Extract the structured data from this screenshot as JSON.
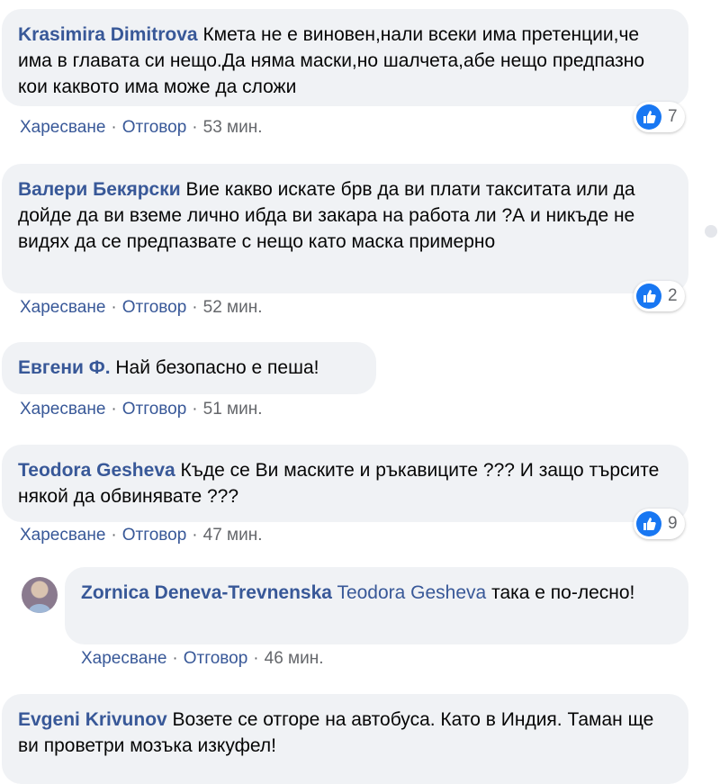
{
  "actions": {
    "like": "Харесване",
    "reply": "Отговор",
    "sep": "·"
  },
  "comments": [
    {
      "author": "Krasimira Dimitrova",
      "text": "Кмета не е виновен,нали всеки има претенции,че има в главата си нещо.Да няма маски,но шалчета,абе нещо предпазно кои каквото има може да сложи",
      "time": "53 мин.",
      "likes": "7"
    },
    {
      "author": "Валери Бекярски",
      "text": "Вие какво искате брв да ви плати такситата или да дойде да ви вземе лично ибда ви закара на работа ли ?А и никъде не видях да се предпазвате с нещо като маска примерно",
      "time": "52 мин.",
      "likes": "2"
    },
    {
      "author": "Евгени Ф.",
      "text": "Най безопасно е пеша!",
      "time": "51 мин."
    },
    {
      "author": "Teodora Gesheva",
      "text": "Къде се Ви маските и ръкавиците ??? И защо търсите някой да обвинявате ???",
      "time": "47 мин.",
      "likes": "9"
    },
    {
      "author": "Zornica Deneva-Trevnenska",
      "mention": "Teodora Gesheva",
      "text": "така е по-лесно!",
      "time": "46 мин."
    },
    {
      "author": "Evgeni Krivunov",
      "text": "Возете се отгоре на автобуса. Като в Индия. Таман ще ви проветри мозъка изкуфел!"
    }
  ]
}
